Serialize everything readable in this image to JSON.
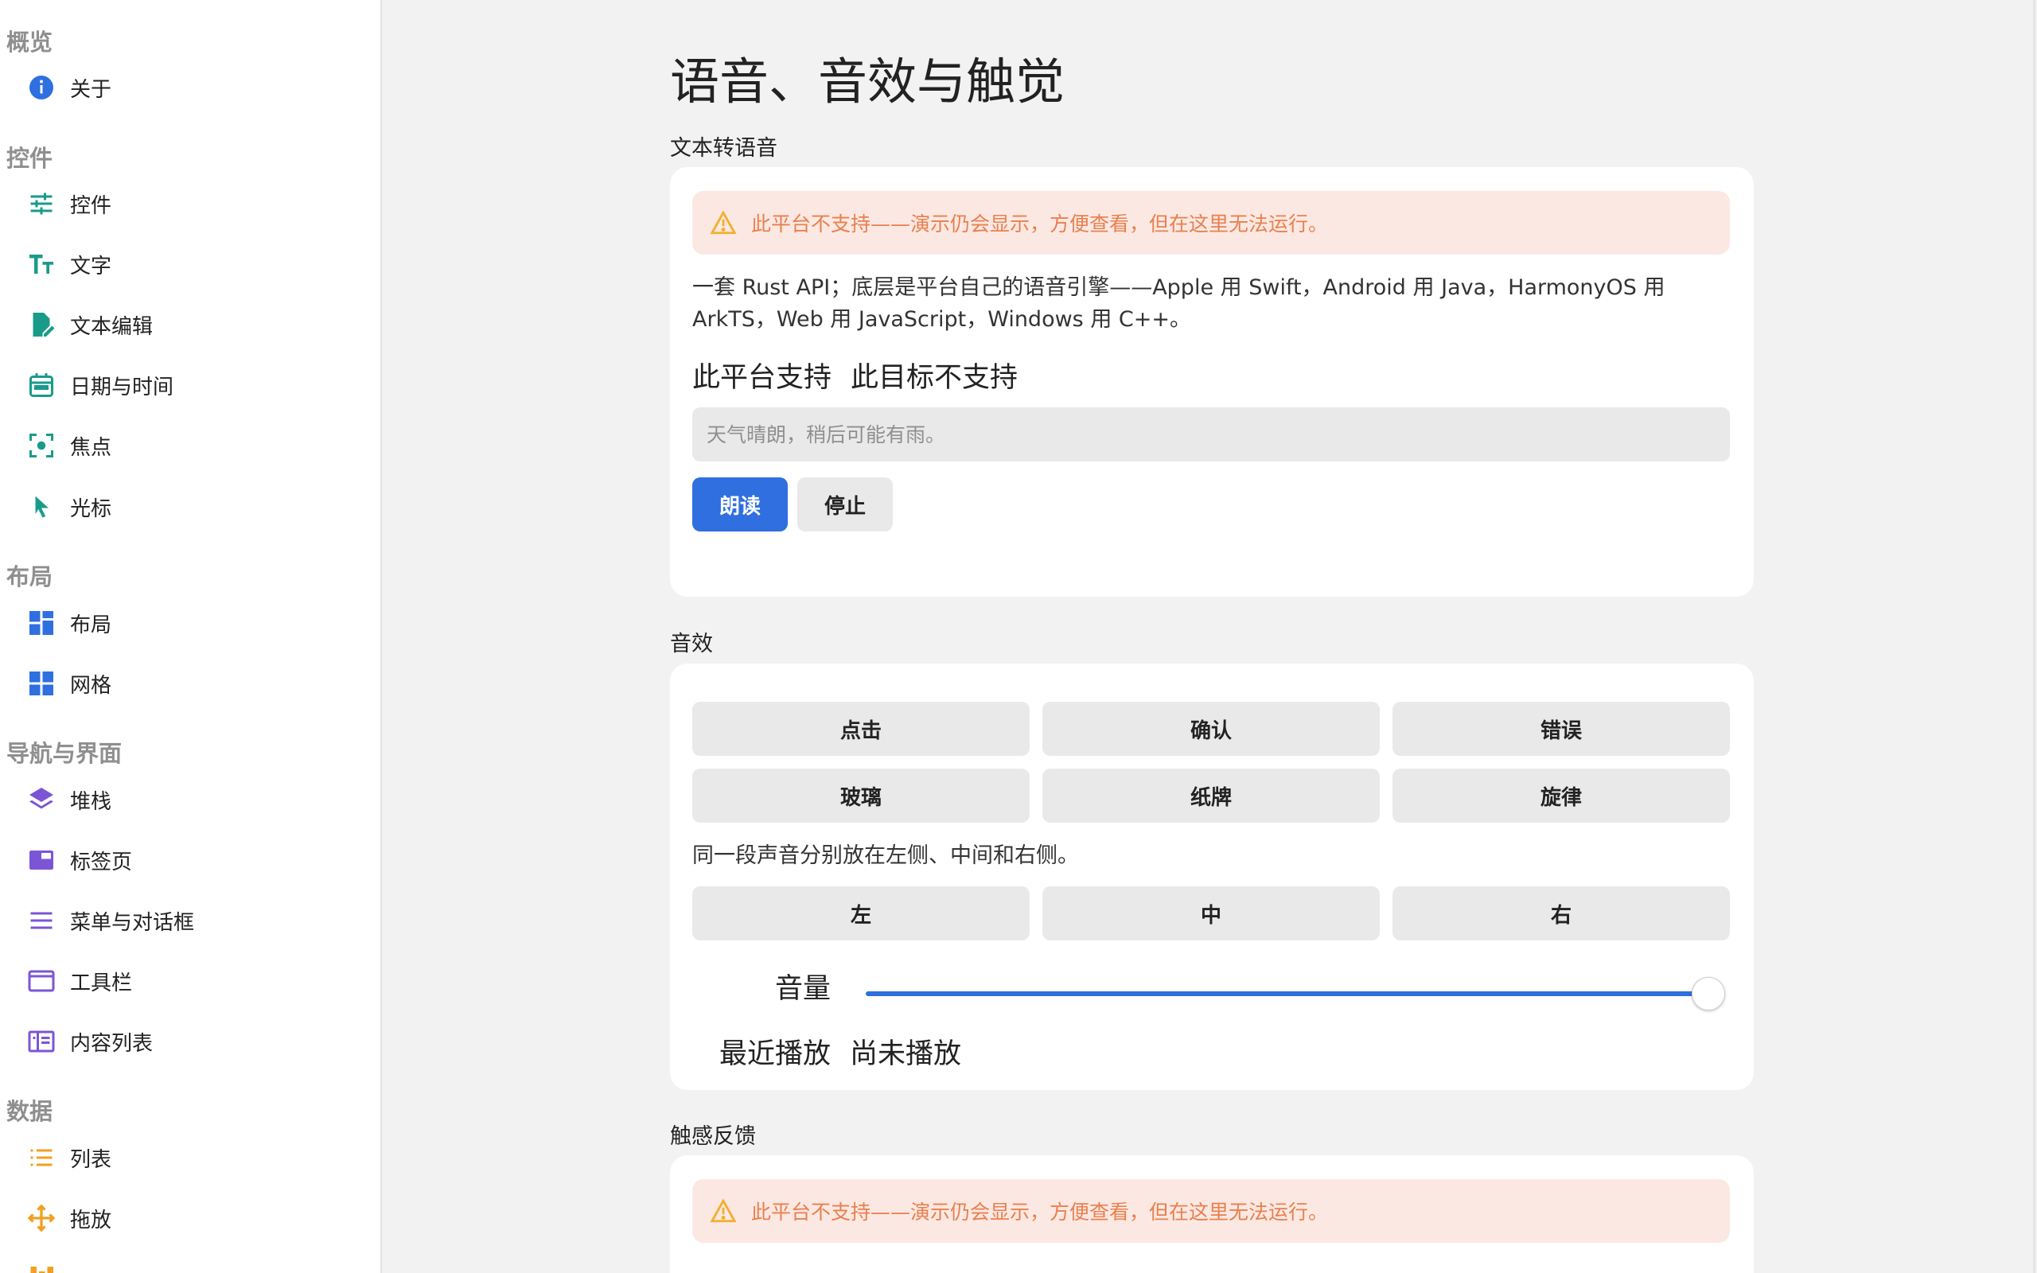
{
  "sidebar": {
    "sections": [
      {
        "title": "概览",
        "items": [
          {
            "label": "关于",
            "icon": "info-icon"
          }
        ]
      },
      {
        "title": "控件",
        "items": [
          {
            "label": "控件",
            "icon": "sliders-icon"
          },
          {
            "label": "文字",
            "icon": "text-size-icon"
          },
          {
            "label": "文本编辑",
            "icon": "edit-document-icon"
          },
          {
            "label": "日期与时间",
            "icon": "calendar-icon"
          },
          {
            "label": "焦点",
            "icon": "focus-icon"
          },
          {
            "label": "光标",
            "icon": "cursor-icon"
          }
        ]
      },
      {
        "title": "布局",
        "items": [
          {
            "label": "布局",
            "icon": "layout-icon"
          },
          {
            "label": "网格",
            "icon": "grid-icon"
          }
        ]
      },
      {
        "title": "导航与界面",
        "items": [
          {
            "label": "堆栈",
            "icon": "layers-icon"
          },
          {
            "label": "标签页",
            "icon": "tabs-icon"
          },
          {
            "label": "菜单与对话框",
            "icon": "menu-icon"
          },
          {
            "label": "工具栏",
            "icon": "toolbar-icon"
          },
          {
            "label": "内容列表",
            "icon": "content-list-icon"
          }
        ]
      },
      {
        "title": "数据",
        "items": [
          {
            "label": "列表",
            "icon": "list-icon"
          },
          {
            "label": "拖放",
            "icon": "drag-drop-icon"
          }
        ]
      }
    ]
  },
  "main": {
    "title": "语音、音效与触觉",
    "tts": {
      "group_label": "文本转语音",
      "warning": "此平台不支持——演示仍会显示，方便查看，但在这里无法运行。",
      "description": "一套 Rust API；底层是平台自己的语音引擎——Apple 用 Swift，Android 用 Java，HarmonyOS 用 ArkTS，Web 用 JavaScript，Windows 用 C++。",
      "status_label": "此平台支持",
      "status_value": "此目标不支持",
      "input_placeholder": "天气晴朗，稍后可能有雨。",
      "speak_label": "朗读",
      "stop_label": "停止"
    },
    "sound": {
      "group_label": "音效",
      "effects": [
        "点击",
        "确认",
        "错误",
        "玻璃",
        "纸牌",
        "旋律"
      ],
      "pan_caption": "同一段声音分别放在左侧、中间和右侧。",
      "pan_buttons": [
        "左",
        "中",
        "右"
      ],
      "volume_label": "音量",
      "volume_value": 1.0,
      "recent_label": "最近播放",
      "recent_value": "尚未播放"
    },
    "haptics": {
      "group_label": "触感反馈",
      "warning": "此平台不支持——演示仍会显示，方便查看，但在这里无法运行。"
    }
  },
  "colors": {
    "accent": "#2f6fe0",
    "warning_bg": "#fce8e2",
    "warning_text": "#e8804f",
    "icon_teal": "#1a9b8a",
    "icon_blue": "#2f6fe0",
    "icon_purple": "#7b55d6",
    "icon_orange": "#f0a020"
  }
}
